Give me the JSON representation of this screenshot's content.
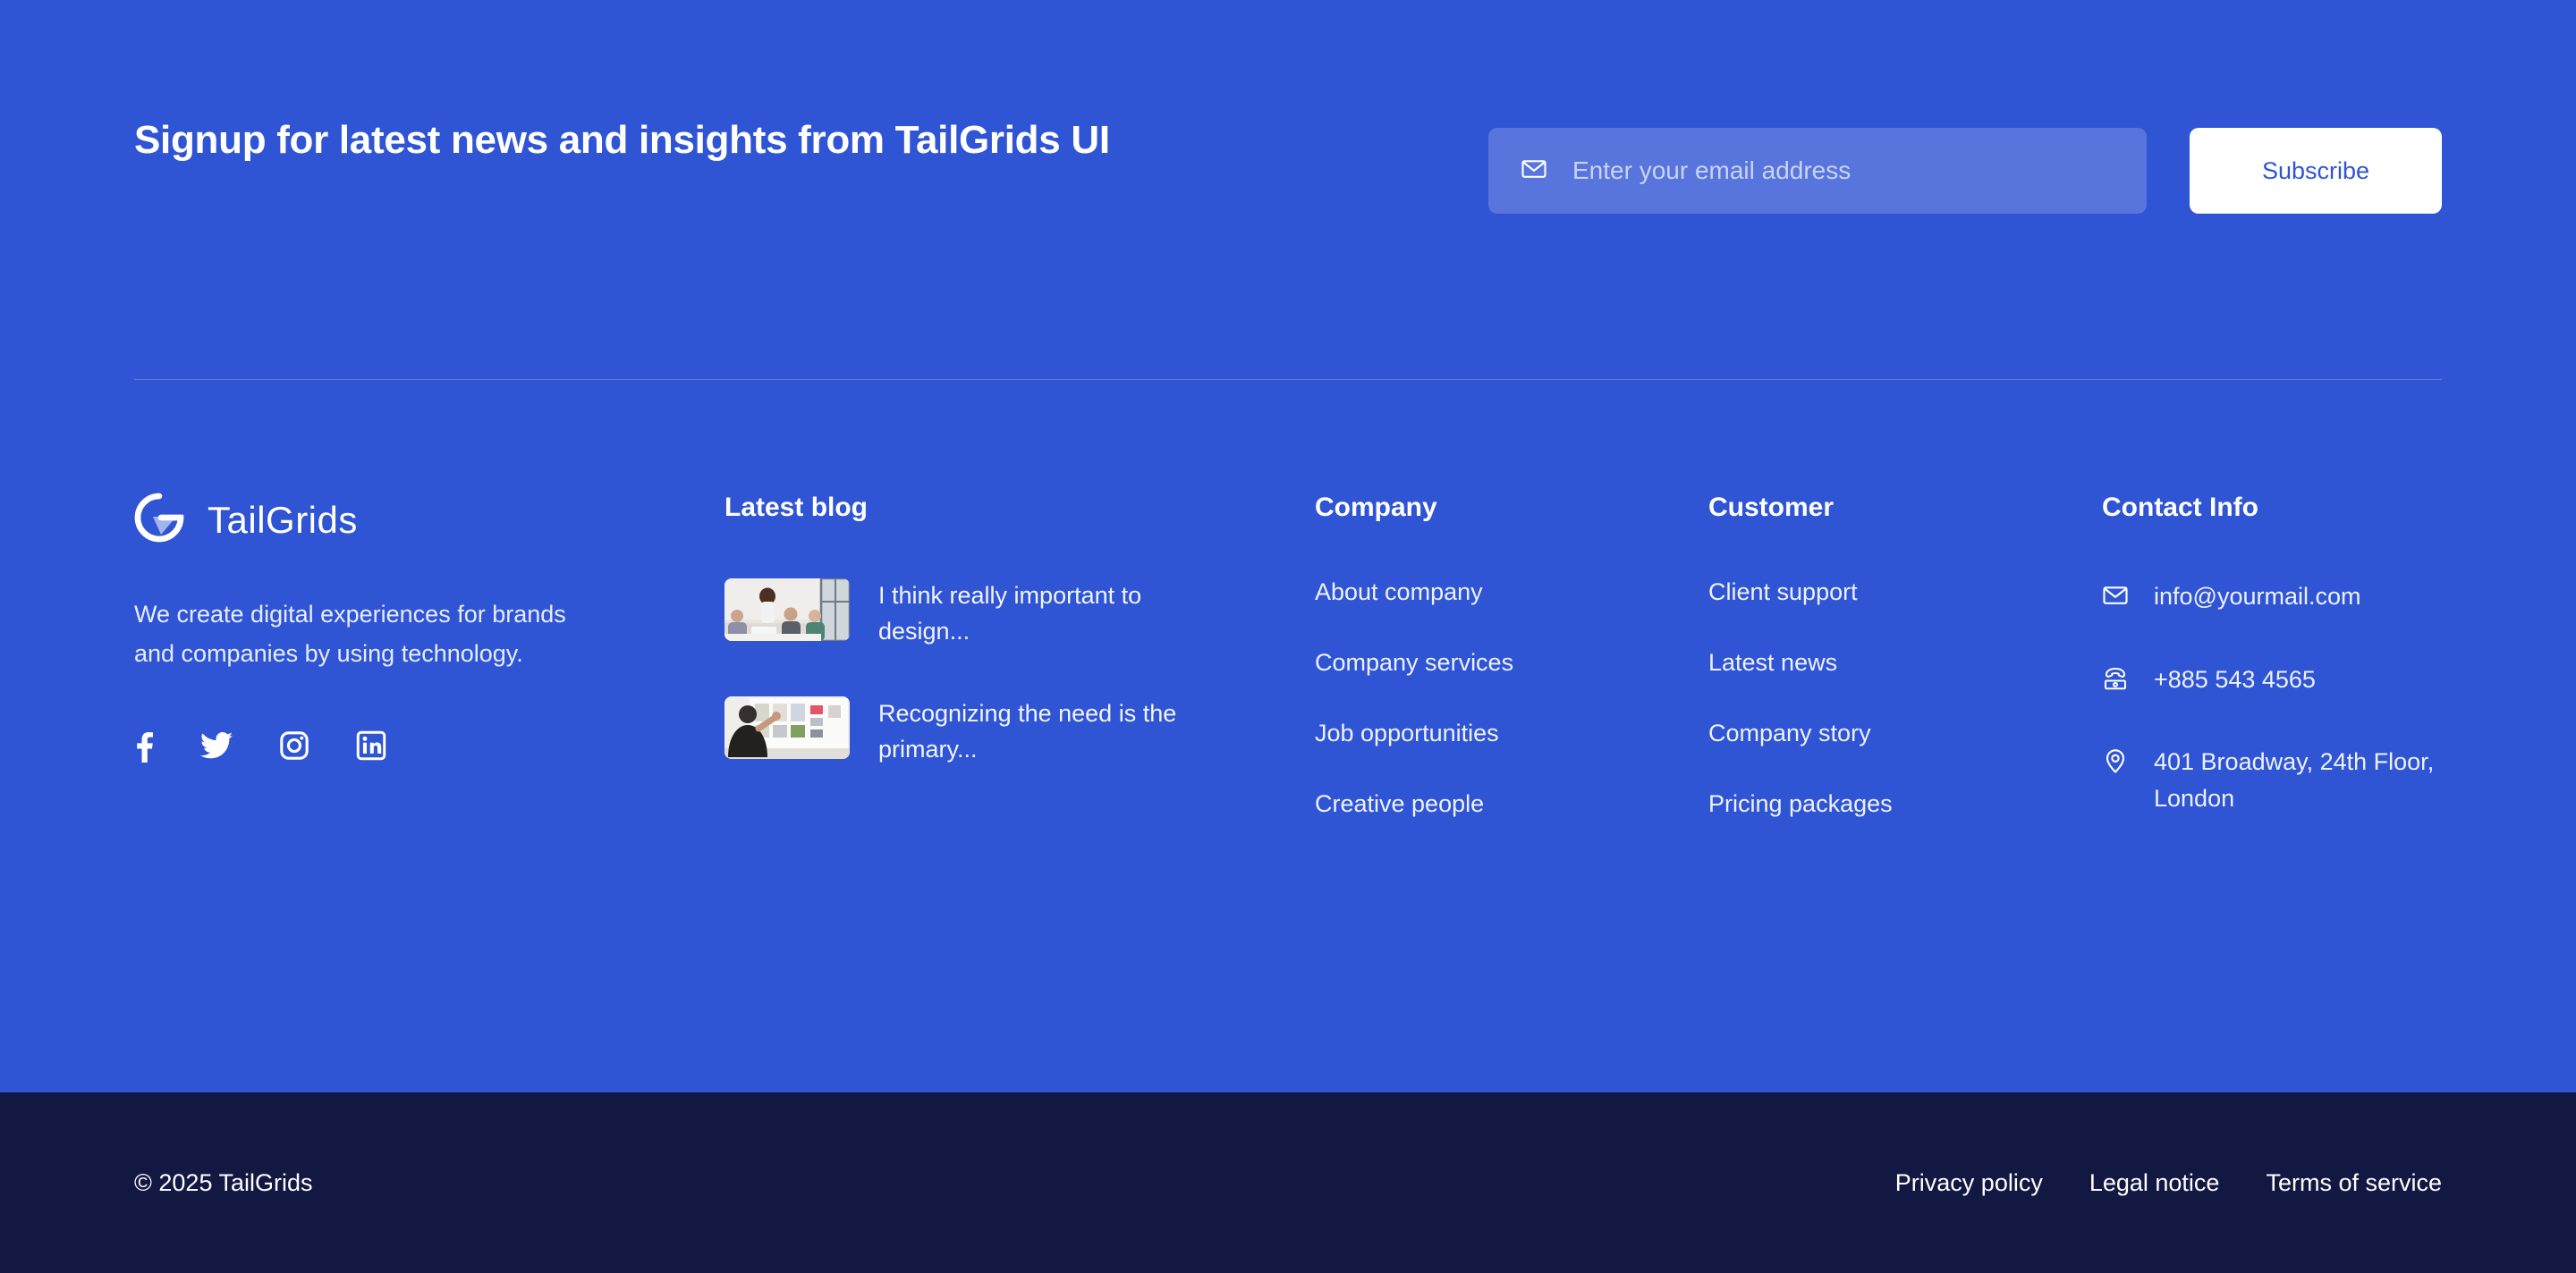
{
  "newsletter": {
    "heading": "Signup for latest news and insights from TailGrids UI",
    "email_placeholder": "Enter your email address",
    "email_value": "",
    "subscribe_label": "Subscribe",
    "mail_icon": "envelope-icon"
  },
  "brand": {
    "logo_text": "TailGrids",
    "logo_mark": "tailgrids-g-logo",
    "description": "We create digital experiences for brands and companies by using technology.",
    "socials": [
      {
        "name": "facebook",
        "icon": "facebook-icon"
      },
      {
        "name": "twitter",
        "icon": "twitter-icon"
      },
      {
        "name": "instagram",
        "icon": "instagram-icon"
      },
      {
        "name": "linkedin",
        "icon": "linkedin-icon"
      }
    ]
  },
  "blog": {
    "title": "Latest blog",
    "posts": [
      {
        "title": "I think really important to design...",
        "thumb": "team-meeting-photo"
      },
      {
        "title": "Recognizing the need is the primary...",
        "thumb": "man-at-whiteboard-photo"
      }
    ]
  },
  "company": {
    "title": "Company",
    "links": [
      "About company",
      "Company services",
      "Job opportunities",
      "Creative people"
    ]
  },
  "customer": {
    "title": "Customer",
    "links": [
      "Client support",
      "Latest news",
      "Company story",
      "Pricing packages"
    ]
  },
  "contact": {
    "title": "Contact Info",
    "items": [
      {
        "icon": "envelope-icon",
        "value": "info@yourmail.com"
      },
      {
        "icon": "telephone-icon",
        "value": "+885 543 4565"
      },
      {
        "icon": "location-pin-icon",
        "value": "401 Broadway, 24th Floor, London"
      }
    ]
  },
  "bottom": {
    "copyright": "© 2025 TailGrids",
    "links": [
      "Privacy policy",
      "Legal notice",
      "Terms of service"
    ]
  },
  "colors": {
    "background": "#2f55d4",
    "bottom_bar": "#131842",
    "input_field": "#5875de",
    "accent_white": "#ffffff"
  }
}
